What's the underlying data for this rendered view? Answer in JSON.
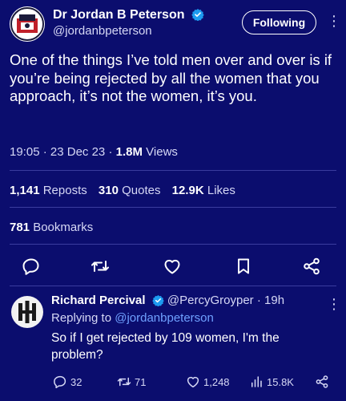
{
  "tweet": {
    "author_name": "Dr Jordan B Peterson",
    "author_handle": "@jordanbpeterson",
    "follow_label": "Following",
    "text": "One of the things I’ve told men over and over is if you’re being rejected by all the women that you approach, it’s not the women, it’s you.",
    "time": "19:05",
    "date": "23 Dec 23",
    "views_count": "1.8M",
    "views_label": "Views",
    "reposts_count": "1,141",
    "reposts_label": "Reposts",
    "quotes_count": "310",
    "quotes_label": "Quotes",
    "likes_count": "12.9K",
    "likes_label": "Likes",
    "bookmarks_count": "781",
    "bookmarks_label": "Bookmarks"
  },
  "reply": {
    "author_name": "Richard Percival",
    "author_handle": "@PercyGroyper",
    "age": "19h",
    "replying_prefix": "Replying to",
    "replying_handle": "@jordanbpeterson",
    "text": "So if I get rejected by 109 women, I'm the problem?",
    "replies": "32",
    "reposts": "71",
    "likes": "1,248",
    "views": "15.8K"
  },
  "icons": {
    "verified": "verified-badge-icon",
    "more": "more-icon",
    "reply": "reply-icon",
    "repost": "repost-icon",
    "like": "heart-icon",
    "bookmark": "bookmark-icon",
    "share": "share-icon",
    "views": "views-icon"
  },
  "colors": {
    "background": "#0b0d6e",
    "verified": "#1d9bf0",
    "mention": "#6fa0ff",
    "secondary_text": "#d6d8f5"
  }
}
